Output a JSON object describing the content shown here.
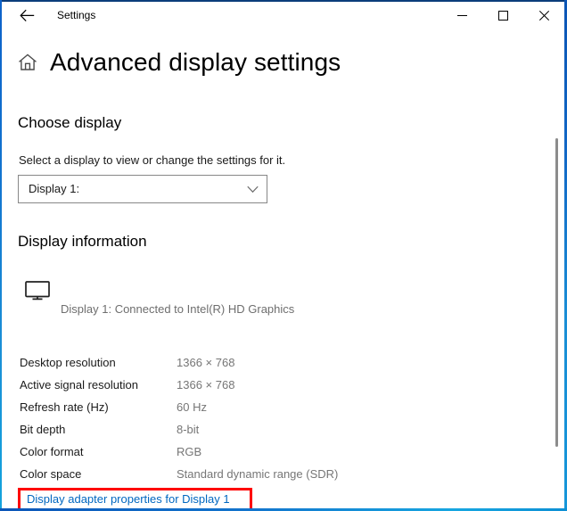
{
  "window": {
    "title": "Settings",
    "back_icon": "back-arrow-icon",
    "minimize_label": "Minimize",
    "maximize_label": "Maximize",
    "close_label": "Close"
  },
  "page": {
    "home_icon": "home-icon",
    "title": "Advanced display settings"
  },
  "choose_display": {
    "heading": "Choose display",
    "helper_text": "Select a display to view or change the settings for it.",
    "dropdown": {
      "value": "Display 1:",
      "chevron_icon": "chevron-down-icon",
      "options": [
        "Display 1:"
      ]
    }
  },
  "display_information": {
    "heading": "Display information",
    "monitor_icon": "monitor-icon",
    "connection_caption": "Display 1: Connected to Intel(R) HD Graphics",
    "rows": [
      {
        "label": "Desktop resolution",
        "value": "1366 × 768"
      },
      {
        "label": "Active signal resolution",
        "value": "1366 × 768"
      },
      {
        "label": "Refresh rate (Hz)",
        "value": "60 Hz"
      },
      {
        "label": "Bit depth",
        "value": "8-bit"
      },
      {
        "label": "Color format",
        "value": "RGB"
      },
      {
        "label": "Color space",
        "value": "Standard dynamic range (SDR)"
      }
    ],
    "adapter_link": "Display adapter properties for Display 1"
  },
  "annotation": {
    "highlight_color": "#fe0000",
    "target": "Display adapter properties for Display 1"
  },
  "colors": {
    "link": "#0067c0",
    "value_text": "#767676",
    "label_text": "#1a1a1a",
    "window_border": "#0d62c9",
    "caption_text": "#6e6e6e"
  }
}
